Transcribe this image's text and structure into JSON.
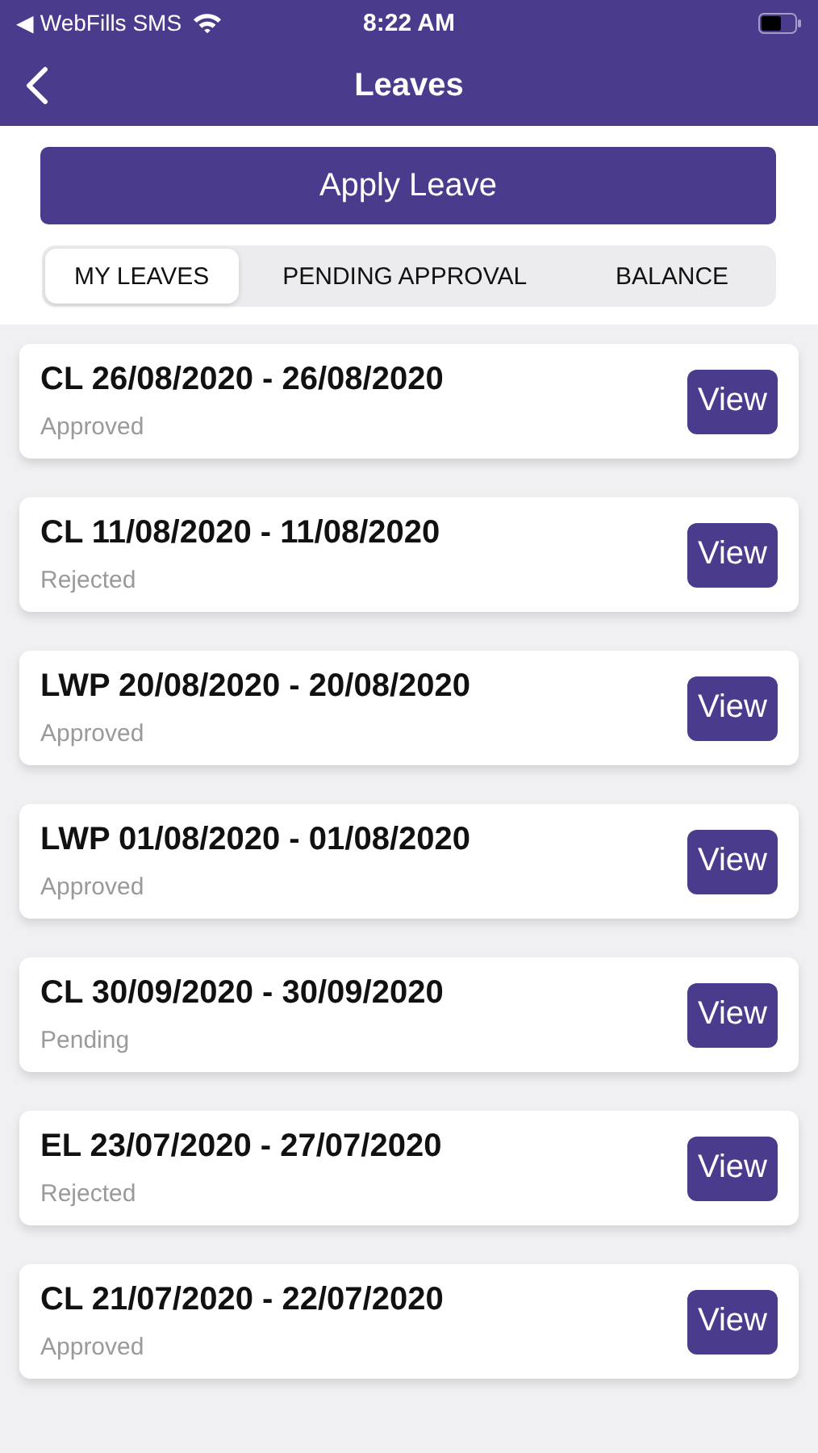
{
  "status_bar": {
    "back_app": "◀ WebFills SMS",
    "time": "8:22 AM"
  },
  "header": {
    "title": "Leaves"
  },
  "apply_button": "Apply Leave",
  "tabs": [
    {
      "label": "MY LEAVES",
      "selected": true
    },
    {
      "label": "PENDING APPROVAL",
      "selected": false
    },
    {
      "label": "BALANCE",
      "selected": false
    }
  ],
  "leaves": [
    {
      "title": "CL 26/08/2020 - 26/08/2020",
      "status": "Approved",
      "action": "View"
    },
    {
      "title": "CL 11/08/2020 - 11/08/2020",
      "status": "Rejected",
      "action": "View"
    },
    {
      "title": "LWP 20/08/2020 - 20/08/2020",
      "status": "Approved",
      "action": "View"
    },
    {
      "title": "LWP 01/08/2020 - 01/08/2020",
      "status": "Approved",
      "action": "View"
    },
    {
      "title": "CL 30/09/2020 - 30/09/2020",
      "status": "Pending",
      "action": "View"
    },
    {
      "title": "EL 23/07/2020 - 27/07/2020",
      "status": "Rejected",
      "action": "View"
    },
    {
      "title": "CL 21/07/2020 - 22/07/2020",
      "status": "Approved",
      "action": "View"
    }
  ]
}
